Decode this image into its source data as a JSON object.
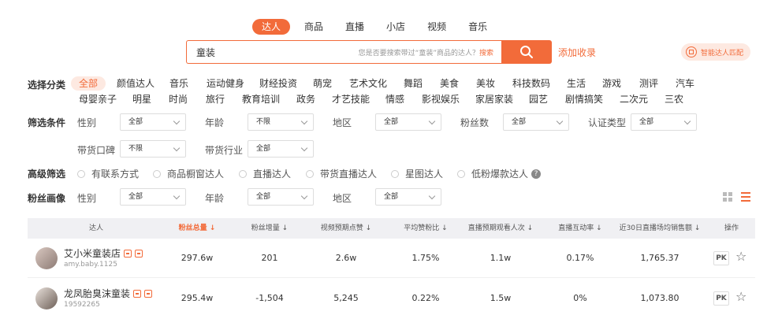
{
  "top_tabs": [
    "达人",
    "商品",
    "直播",
    "小店",
    "视频",
    "音乐"
  ],
  "search": {
    "value": "童装",
    "hint_prefix": "您是否要搜索带过“童装”商品的达人？",
    "hint_link": "搜索"
  },
  "fav_label": "添加收录",
  "smart_match_label": "智能达人匹配",
  "category": {
    "label": "选择分类",
    "row1": [
      "全部",
      "颜值达人",
      "音乐",
      "运动健身",
      "财经投资",
      "萌宠",
      "艺术文化",
      "舞蹈",
      "美食",
      "美妆",
      "科技数码",
      "生活",
      "游戏",
      "测评",
      "汽车"
    ],
    "row2": [
      "母婴亲子",
      "明星",
      "时尚",
      "旅行",
      "教育培训",
      "政务",
      "才艺技能",
      "情感",
      "影视娱乐",
      "家居家装",
      "园艺",
      "剧情搞笑",
      "二次元",
      "三农"
    ]
  },
  "filters": {
    "label": "筛选条件",
    "items": [
      {
        "label": "性别",
        "value": "全部"
      },
      {
        "label": "年龄",
        "value": "不限"
      },
      {
        "label": "地区",
        "value": "全部"
      },
      {
        "label": "粉丝数",
        "value": "全部"
      },
      {
        "label": "认证类型",
        "value": "全部"
      },
      {
        "label": "带货口碑",
        "value": "不限"
      },
      {
        "label": "带货行业",
        "value": "全部"
      }
    ]
  },
  "advanced": {
    "label": "高级筛选",
    "options": [
      "有联系方式",
      "商品橱窗达人",
      "直播达人",
      "带货直播达人",
      "星图达人",
      "低粉爆款达人"
    ],
    "help": "?"
  },
  "fans_profile": {
    "label": "粉丝画像",
    "items": [
      {
        "label": "性别",
        "value": "全部"
      },
      {
        "label": "年龄",
        "value": "全部"
      },
      {
        "label": "地区",
        "value": "全部"
      }
    ]
  },
  "table": {
    "headers": [
      "达人",
      "粉丝总量 ↓",
      "粉丝增量 ↓",
      "视频预期点赞 ↓",
      "平均赞粉比 ↓",
      "直播预期观看人次 ↓",
      "直播互动率 ↓",
      "近30日直播场均销售额 ↓",
      "操作"
    ],
    "rows": [
      {
        "name": "艾小米童装店",
        "account": "amy.baby.1125",
        "cells": [
          "297.6w",
          "201",
          "2.6w",
          "1.75%",
          "1.1w",
          "0.17%",
          "1,765.37"
        ],
        "pk": "PK"
      },
      {
        "name": "龙凤胎臭沫童装",
        "account": "19592265",
        "cells": [
          "295.4w",
          "-1,504",
          "5,245",
          "0.22%",
          "1.5w",
          "0%",
          "1,073.80"
        ],
        "pk": "PK"
      }
    ]
  }
}
